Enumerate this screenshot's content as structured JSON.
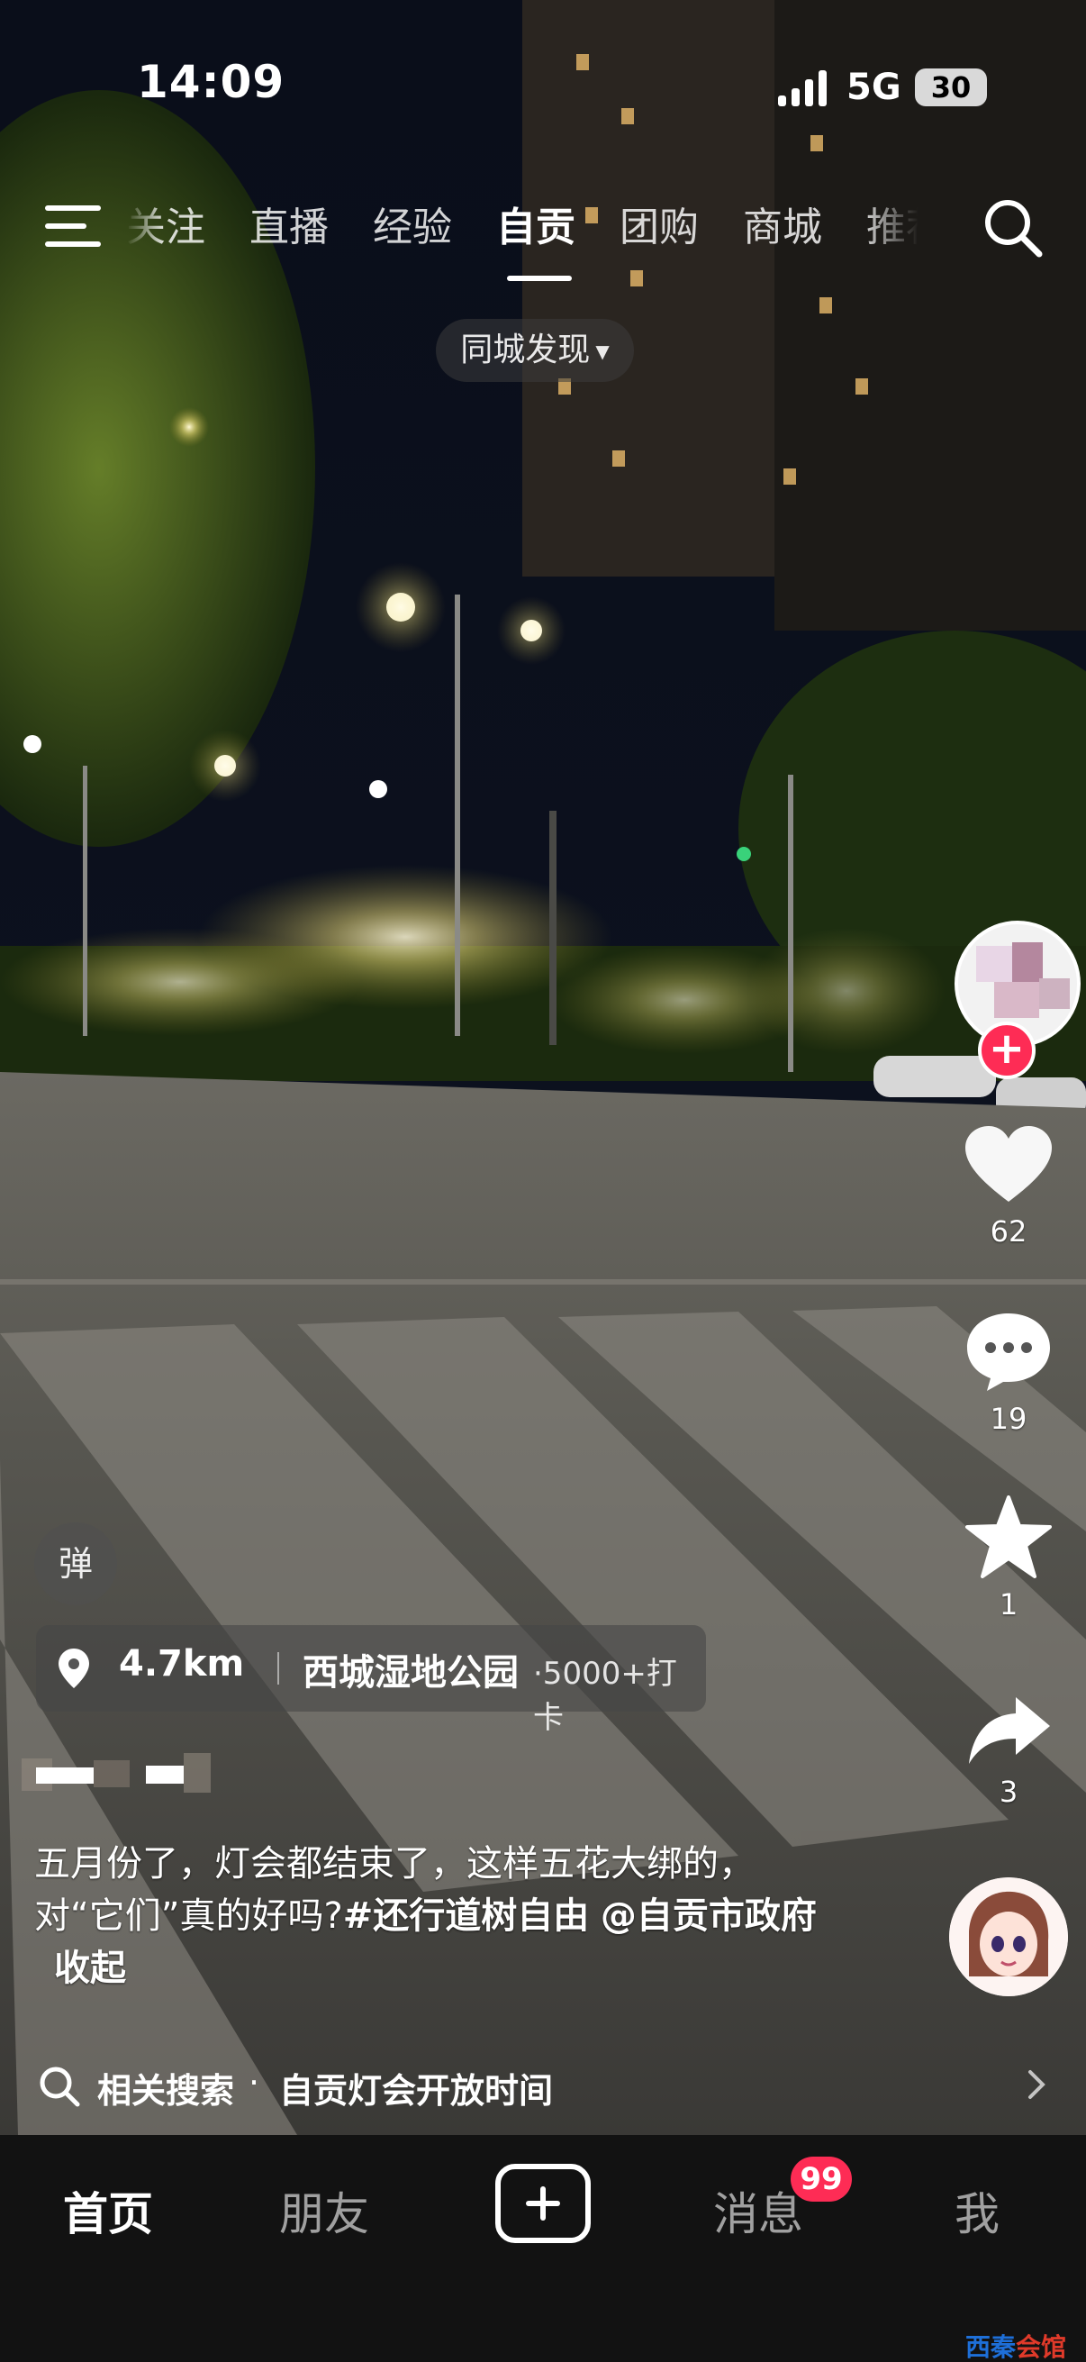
{
  "status_bar": {
    "time": "14:09",
    "network": "5G",
    "battery": "30"
  },
  "top_nav": {
    "menu_icon": "menu-icon",
    "tabs": [
      {
        "label": "关注",
        "active": false
      },
      {
        "label": "直播",
        "active": false
      },
      {
        "label": "经验",
        "active": false
      },
      {
        "label": "自贡",
        "active": true
      },
      {
        "label": "团购",
        "active": false
      },
      {
        "label": "商城",
        "active": false
      },
      {
        "label": "推荐",
        "active": false
      }
    ],
    "search_icon": "search-icon",
    "city_filter": "同城发现"
  },
  "actions": {
    "follow_icon": "plus-icon",
    "like_count": "62",
    "comment_count": "19",
    "favorite_count": "1",
    "share_count": "3"
  },
  "video_info": {
    "danmu_label": "弹",
    "location": {
      "distance": "4.7km",
      "place": "西城湿地公园",
      "checkins": "·5000+打卡"
    },
    "caption": {
      "text_line1": "五月份了，灯会都结束了，这样五花大绑的，",
      "text_line2_prefix": "对“它们”真的好吗?",
      "hashtag": "#还行道树自由",
      "mention": "@自贡市政府",
      "fold_label": "收起"
    },
    "related_search": {
      "label": "相关搜索",
      "dot": "·",
      "query": "自贡灯会开放时间"
    }
  },
  "tab_bar": {
    "home": "首页",
    "friends": "朋友",
    "messages": "消息",
    "messages_badge": "99",
    "me": "我"
  },
  "watermark": {
    "part_a": "西秦",
    "part_b": "会馆"
  },
  "colors": {
    "accent": "#fe2c55",
    "tab_bar_bg": "#121212",
    "sky": "#0b0f1c"
  }
}
